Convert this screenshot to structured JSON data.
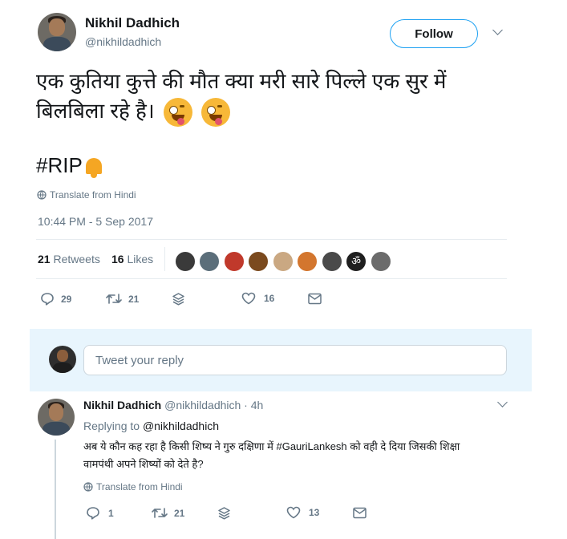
{
  "tweet": {
    "author_name": "Nikhil Dadhich",
    "author_handle": "@nikhildadhich",
    "follow_label": "Follow",
    "text_line1": "एक कुतिया कुत्ते की मौत क्या मरी सारे पिल्ले एक सुर में",
    "text_line2": "बिलबिला रहे है।",
    "hashtag": "#RIP",
    "translate_label": "Translate from Hindi",
    "timestamp": "10:44 PM - 5 Sep 2017",
    "retweets_count": "21",
    "retweets_label": "Retweets",
    "likes_count": "16",
    "likes_label": "Likes",
    "actions": {
      "reply_count": "29",
      "retweet_count": "21",
      "like_count": "16"
    }
  },
  "reply_composer": {
    "placeholder": "Tweet your reply"
  },
  "reply": {
    "author_name": "Nikhil Dadhich",
    "author_handle": "@nikhildadhich",
    "time": "· 4h",
    "replying_prefix": "Replying to",
    "replying_handle": "@nikhildadhich",
    "text_line1": "अब ये कौन कह रहा है किसी शिष्य ने गुरु दक्षिणा में #GauriLankesh को वही दे दिया जिसकी शिक्षा",
    "text_line2": "वामपंथी अपने शिष्यों को देते है?",
    "translate_label": "Translate from Hindi",
    "actions": {
      "reply_count": "1",
      "retweet_count": "21",
      "like_count": "13"
    }
  },
  "colors": {
    "accent": "#1da1f2",
    "muted": "#657786",
    "border": "#e6ecf0"
  }
}
